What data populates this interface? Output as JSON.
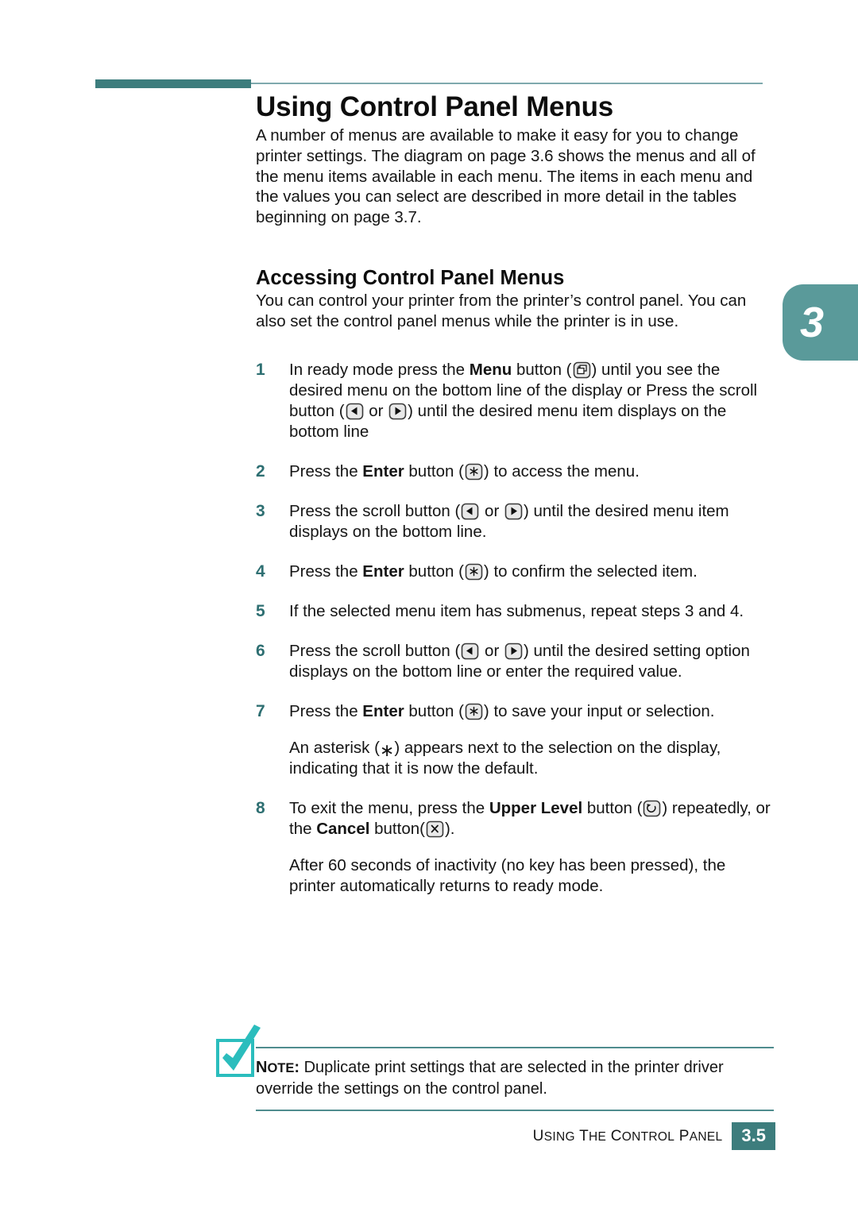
{
  "page": {
    "title": "Using Control Panel Menus",
    "chapter_tab": "3",
    "accent_teal": "#3d7d7d",
    "tab_teal": "#5a9a9a",
    "check_teal": "#2bbdbd",
    "step_number_color": "#2e6f72"
  },
  "intro": {
    "paragraph": "A number of menus are available to make it easy for you to change printer settings. The diagram on page 3.6 shows the menus and all of the menu items available in each menu. The items in each menu and the values you can select are described in more detail in the tables beginning on page 3.7."
  },
  "section": {
    "heading": "Accessing Control Panel Menus",
    "lead": "You can control your printer from the printer’s control panel. You can also set the control panel menus while the printer is in use."
  },
  "steps": [
    {
      "number": "1",
      "parts": [
        {
          "type": "text",
          "text": "In ready mode press the "
        },
        {
          "type": "bold",
          "text": "Menu"
        },
        {
          "type": "text",
          "text": " button ("
        },
        {
          "type": "icon",
          "icon": "menu-key-icon"
        },
        {
          "type": "text",
          "text": ") until you see the desired menu on the bottom line of the display or Press the scroll button ("
        },
        {
          "type": "icon",
          "icon": "scroll-left-key-icon"
        },
        {
          "type": "text",
          "text": " or "
        },
        {
          "type": "icon",
          "icon": "scroll-right-key-icon"
        },
        {
          "type": "text",
          "text": ") until the desired menu item displays on the bottom line"
        }
      ]
    },
    {
      "number": "2",
      "parts": [
        {
          "type": "text",
          "text": "Press the "
        },
        {
          "type": "bold",
          "text": "Enter"
        },
        {
          "type": "text",
          "text": " button ("
        },
        {
          "type": "icon",
          "icon": "enter-key-icon"
        },
        {
          "type": "text",
          "text": ") to access the menu."
        }
      ]
    },
    {
      "number": "3",
      "parts": [
        {
          "type": "text",
          "text": "Press the scroll button ("
        },
        {
          "type": "icon",
          "icon": "scroll-left-key-icon"
        },
        {
          "type": "text",
          "text": " or "
        },
        {
          "type": "icon",
          "icon": "scroll-right-key-icon"
        },
        {
          "type": "text",
          "text": ") until the desired menu item displays on the bottom line."
        }
      ]
    },
    {
      "number": "4",
      "parts": [
        {
          "type": "text",
          "text": "Press the "
        },
        {
          "type": "bold",
          "text": "Enter"
        },
        {
          "type": "text",
          "text": " button ("
        },
        {
          "type": "icon",
          "icon": "enter-key-icon"
        },
        {
          "type": "text",
          "text": ") to confirm the selected item."
        }
      ]
    },
    {
      "number": "5",
      "parts": [
        {
          "type": "text",
          "text": "If the selected menu item has submenus, repeat steps 3 and 4."
        }
      ]
    },
    {
      "number": "6",
      "parts": [
        {
          "type": "text",
          "text": "Press the scroll button ("
        },
        {
          "type": "icon",
          "icon": "scroll-left-key-icon"
        },
        {
          "type": "text",
          "text": " or "
        },
        {
          "type": "icon",
          "icon": "scroll-right-key-icon"
        },
        {
          "type": "text",
          "text": ") until the desired setting option displays on the bottom line or enter the required value."
        }
      ]
    },
    {
      "number": "7",
      "parts": [
        {
          "type": "text",
          "text": "Press the "
        },
        {
          "type": "bold",
          "text": "Enter"
        },
        {
          "type": "text",
          "text": " button ("
        },
        {
          "type": "icon",
          "icon": "enter-key-icon"
        },
        {
          "type": "text",
          "text": ") to save your input or selection."
        }
      ],
      "sub_paragraph": [
        {
          "type": "text",
          "text": "An asterisk ("
        },
        {
          "type": "glyph",
          "text": "∗"
        },
        {
          "type": "text",
          "text": ") appears next to the selection on the display, indicating that it is now the default."
        }
      ]
    },
    {
      "number": "8",
      "parts": [
        {
          "type": "text",
          "text": "To exit the menu, press the "
        },
        {
          "type": "bold",
          "text": "Upper Level"
        },
        {
          "type": "text",
          "text": " button ("
        },
        {
          "type": "icon",
          "icon": "upper-level-key-icon"
        },
        {
          "type": "text",
          "text": ") repeatedly, or the "
        },
        {
          "type": "bold",
          "text": "Cancel"
        },
        {
          "type": "text",
          "text": " button("
        },
        {
          "type": "icon",
          "icon": "cancel-key-icon"
        },
        {
          "type": "text",
          "text": ")."
        }
      ],
      "sub_paragraph": [
        {
          "type": "text",
          "text": "After 60 seconds of inactivity (no key has been pressed), the printer automatically returns to ready mode."
        }
      ]
    }
  ],
  "note": {
    "label_first": "N",
    "label_rest": "OTE",
    "label_colon": ":",
    "text": " Duplicate print settings that are selected in the printer driver override the settings on the control panel."
  },
  "footer": {
    "label_parts": [
      {
        "cap": "U",
        "rest": "SING"
      },
      {
        "cap": "T",
        "rest": "HE"
      },
      {
        "cap": "C",
        "rest": "ONTROL"
      },
      {
        "cap": "P",
        "rest": "ANEL"
      }
    ],
    "page_number": "3.5"
  }
}
